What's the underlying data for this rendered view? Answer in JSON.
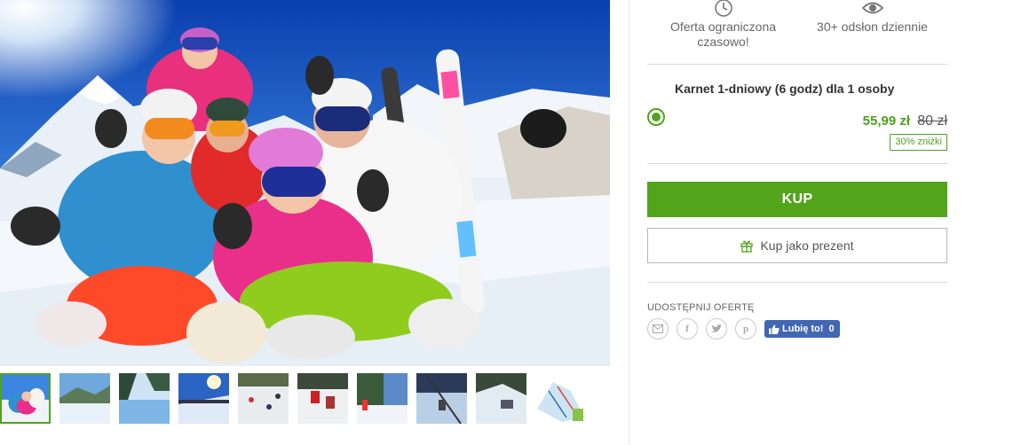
{
  "features": [
    {
      "icon": "clock-icon",
      "text": "Oferta ograniczona czasowo!"
    },
    {
      "icon": "eye-icon",
      "text": "30+ odsłon dziennie"
    }
  ],
  "offer": {
    "title": "Karnet 1-dniowy (6 godz) dla 1 osoby",
    "selected": true,
    "price_new": "55,99 zł",
    "price_old": "80 zł",
    "discount": "30% zniżki"
  },
  "buttons": {
    "buy": "KUP",
    "gift": "Kup jako prezent"
  },
  "share": {
    "label": "UDOSTĘPNIJ OFERTĘ",
    "icons": [
      "email-icon",
      "facebook-icon",
      "twitter-icon",
      "pinterest-icon"
    ],
    "fb_like_label": "Lubię to!",
    "fb_like_count": "0"
  },
  "gallery": {
    "thumbnail_count": 10,
    "active_index": 0
  },
  "colors": {
    "accent_green": "#52a51b",
    "facebook_blue": "#4267b2"
  }
}
